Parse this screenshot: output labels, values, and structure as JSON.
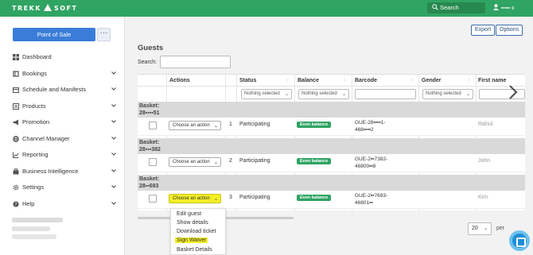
{
  "topbar": {
    "logo_left": "TREKK",
    "logo_right": "SOFT",
    "search_label": "Search",
    "user_name": "▪▪▪▪▪ k"
  },
  "sidebar": {
    "pos_label": "Point of Sale",
    "more_label": "···",
    "items": [
      {
        "label": "Dashboard",
        "icon": "dashboard-icon",
        "chevron": false
      },
      {
        "label": "Bookings",
        "icon": "bookings-icon",
        "chevron": true
      },
      {
        "label": "Schedule and Manifests",
        "icon": "calendar-icon",
        "chevron": true
      },
      {
        "label": "Products",
        "icon": "products-icon",
        "chevron": true
      },
      {
        "label": "Promotion",
        "icon": "megaphone-icon",
        "chevron": true
      },
      {
        "label": "Channel Manager",
        "icon": "globe-icon",
        "chevron": true
      },
      {
        "label": "Reporting",
        "icon": "chart-icon",
        "chevron": true
      },
      {
        "label": "Business Intelligence",
        "icon": "briefcase-icon",
        "chevron": true
      },
      {
        "label": "Settings",
        "icon": "gear-icon",
        "chevron": true
      },
      {
        "label": "Help",
        "icon": "help-icon",
        "chevron": true
      }
    ]
  },
  "main": {
    "export_label": "Export",
    "options_label": "Options",
    "title": "Guests",
    "search_label": "Search:",
    "columns": [
      "Actions",
      "Status",
      "Balance",
      "Barcode",
      "Gender",
      "First name"
    ],
    "filter_placeholder": "Nothing selected",
    "rows": [
      {
        "basket_label": "Basket:",
        "basket_id": "28▪▪▪▪51",
        "action": "Choose an action",
        "num": "1",
        "status": "Participating",
        "balance": "Even balance",
        "barcode1": "GUE-28▪▪▪▪1-",
        "barcode2": "468▪▪▪▪2",
        "first_name": "Rahul"
      },
      {
        "basket_label": "Basket:",
        "basket_id": "28▪▪▪382",
        "action": "Choose an action",
        "num": "2",
        "status": "Participating",
        "balance": "Even balance",
        "barcode1": "GUE-2▪▪7382-",
        "barcode2": "46800▪▪8",
        "first_name": "John"
      },
      {
        "basket_label": "Basket:",
        "basket_id": "28▪▪693",
        "action": "Choose an action",
        "num": "3",
        "status": "Participating",
        "balance": "Even balance",
        "barcode1": "GUE-2▪▪7693-",
        "barcode2": "46801▪▪",
        "first_name": "Kim"
      }
    ],
    "dropdown": [
      "Edit guest",
      "Show details",
      "Download ticket",
      "Sign Waiver",
      "Basket Details"
    ],
    "highlighted_option": "Sign Waiver",
    "page_size": "20",
    "per_page_label": "per"
  },
  "colors": {
    "topbar": "#2fa463",
    "primary": "#3a7dd8",
    "highlight": "#f3ef27",
    "badge": "#2fa463"
  }
}
